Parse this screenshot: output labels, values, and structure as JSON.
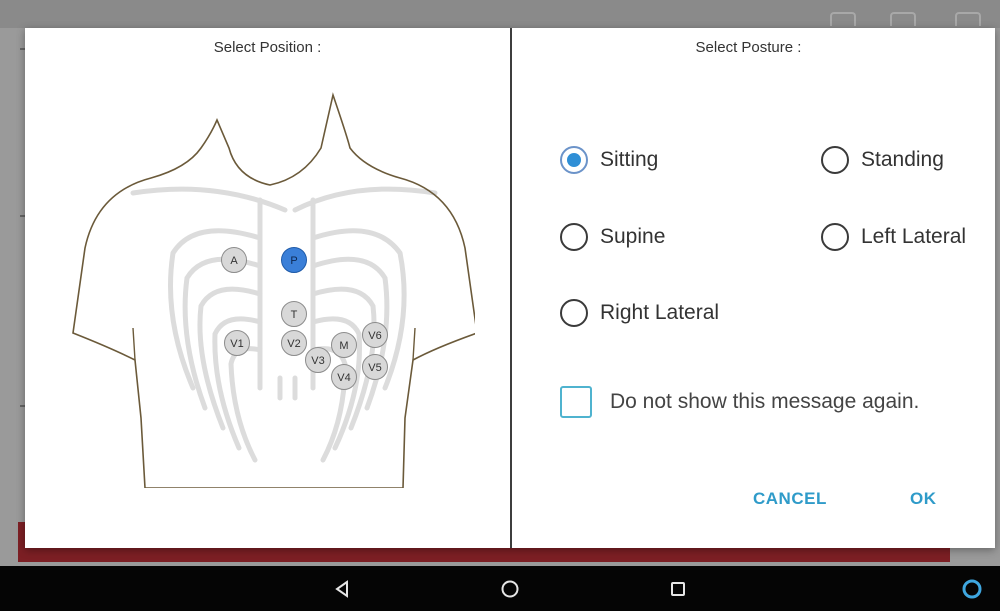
{
  "position_panel": {
    "title": "Select Position :",
    "markers": [
      {
        "label": "A",
        "selected": false
      },
      {
        "label": "P",
        "selected": true
      },
      {
        "label": "T",
        "selected": false
      },
      {
        "label": "V1",
        "selected": false
      },
      {
        "label": "V2",
        "selected": false
      },
      {
        "label": "M",
        "selected": false
      },
      {
        "label": "V6",
        "selected": false
      },
      {
        "label": "V3",
        "selected": false
      },
      {
        "label": "V4",
        "selected": false
      },
      {
        "label": "V5",
        "selected": false
      }
    ]
  },
  "posture_panel": {
    "title": "Select Posture :",
    "options": [
      {
        "label": "Sitting",
        "checked": true
      },
      {
        "label": "Standing",
        "checked": false
      },
      {
        "label": "Supine",
        "checked": false
      },
      {
        "label": "Left Lateral",
        "checked": false
      },
      {
        "label": "Right Lateral",
        "checked": false
      }
    ],
    "dont_show_again": {
      "label": "Do not show this message again.",
      "checked": false
    }
  },
  "buttons": {
    "cancel": "CANCEL",
    "ok": "OK"
  },
  "navbar": {
    "back_icon": "back-triangle",
    "home_icon": "home-circle",
    "recents_icon": "recents-square",
    "assistant_icon": "assistant-ring"
  },
  "colors": {
    "selected_marker": "#3a7fd8",
    "radio_checked": "#2f8fd6",
    "accent": "#2f9bc9",
    "app_red": "#7c1f24"
  }
}
